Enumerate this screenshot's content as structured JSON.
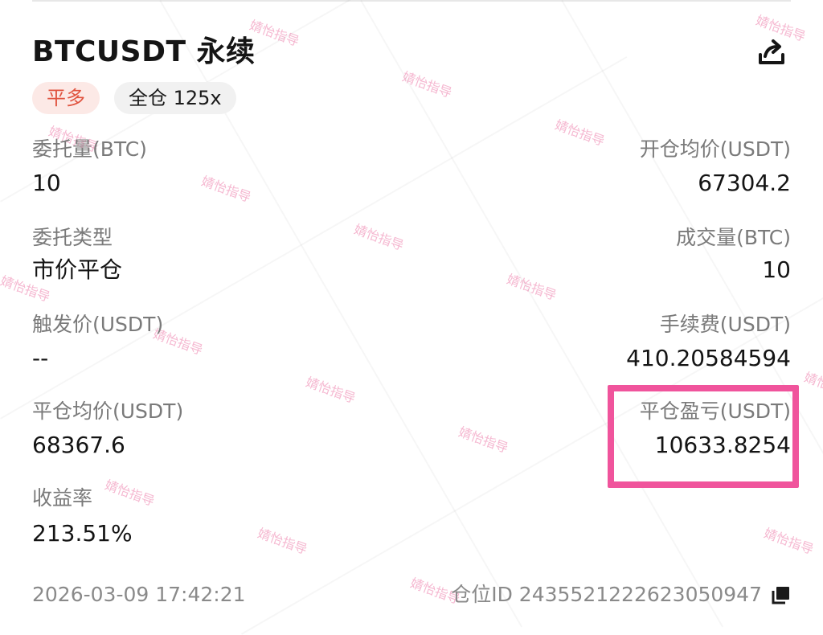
{
  "header": {
    "title": "BTCUSDT 永续",
    "share_icon": "share-icon"
  },
  "tags": {
    "side": "平多",
    "mode": "全仓 125x"
  },
  "fields": {
    "order_qty_label": "委托量(BTC)",
    "order_qty_value": "10",
    "open_avg_label": "开仓均价(USDT)",
    "open_avg_value": "67304.2",
    "order_type_label": "委托类型",
    "order_type_value": "市价平仓",
    "filled_qty_label": "成交量(BTC)",
    "filled_qty_value": "10",
    "trigger_label": "触发价(USDT)",
    "trigger_value": "--",
    "fee_label": "手续费(USDT)",
    "fee_value": "410.20584594",
    "close_avg_label": "平仓均价(USDT)",
    "close_avg_value": "68367.6",
    "pnl_label": "平仓盈亏(USDT)",
    "pnl_value": "10633.8254",
    "roi_label": "收益率",
    "roi_value": "213.51%"
  },
  "footer": {
    "timestamp": "2026-03-09 17:42:21",
    "position_id": "仓位ID 2435521222623050947",
    "copy_icon": "copy-icon"
  },
  "watermark": "婧怡指导",
  "colors": {
    "side_tag_bg": "#fce9e6",
    "side_tag_text": "#e0533f",
    "highlight_border": "#f0549c",
    "watermark": "#e86096"
  }
}
